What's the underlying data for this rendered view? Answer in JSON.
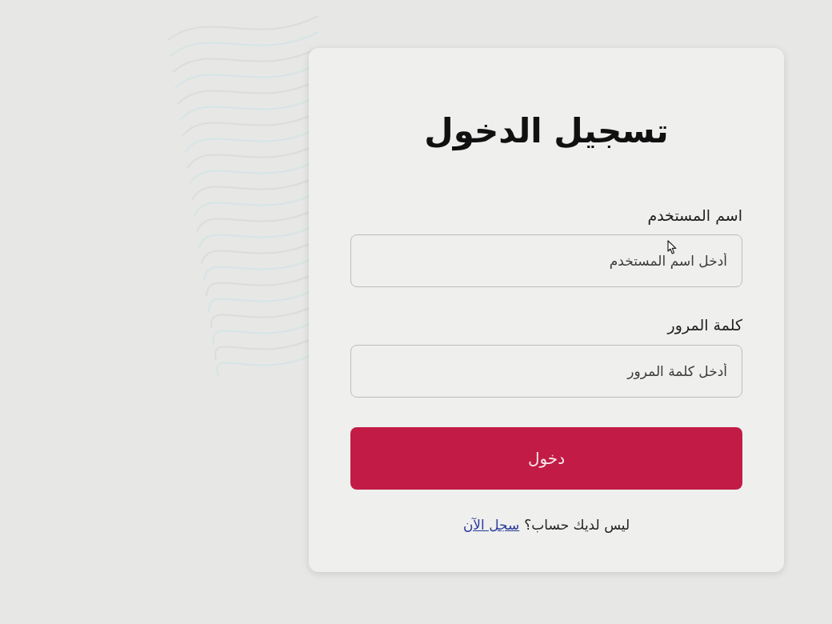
{
  "title": "تسجيل الدخول",
  "form": {
    "fields": [
      {
        "label": "اسم المستخدم",
        "placeholder": "أدخل اسم المستخدم"
      },
      {
        "label": "كلمة المرور",
        "placeholder": "أدخل كلمة المرور"
      }
    ],
    "submit_button": "دخول"
  },
  "signup_prompt": {
    "text": "ليس لديك حساب؟",
    "link": "سجل الآن"
  }
}
